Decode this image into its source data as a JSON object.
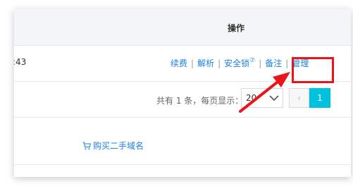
{
  "table": {
    "operation_header": "操作",
    "row": {
      "time_partial": ":43",
      "actions": [
        "续费",
        "解析",
        "安全锁",
        "备注",
        "管理"
      ],
      "separator": "|",
      "lock_help_glyph": "⑦"
    },
    "pagination": {
      "summary": "共有 1 条，每页显示：",
      "page_size": "20",
      "prev_label": "‹",
      "current_page": "1"
    },
    "buy_second_hand_domain": "购买二手域名"
  },
  "annotation": {
    "highlight_color": "#e8151b",
    "target": "管理"
  },
  "colors": {
    "link": "#1e80e6",
    "pager_active": "#00c1de",
    "header_bg": "#f4f5f6"
  }
}
